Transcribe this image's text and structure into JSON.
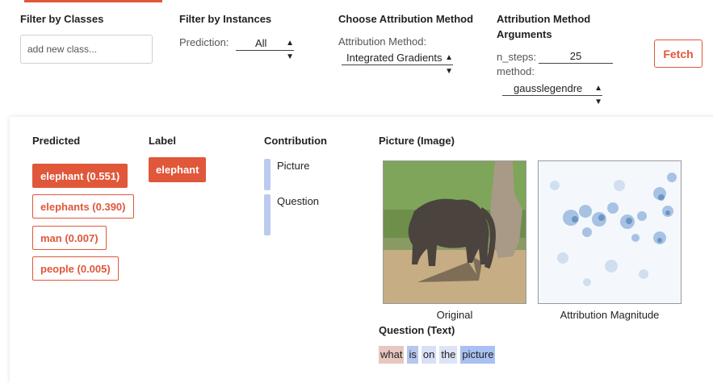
{
  "filters": {
    "classes": {
      "title": "Filter by Classes",
      "placeholder": "add new class..."
    },
    "instances": {
      "title": "Filter by Instances",
      "prediction_label": "Prediction:",
      "prediction_value": "All"
    },
    "attribution": {
      "title": "Choose Attribution Method",
      "method_label": "Attribution Method:",
      "method_value": "Integrated Gradients"
    },
    "arguments": {
      "title": "Attribution Method Arguments",
      "n_steps_label": "n_steps:",
      "n_steps_value": "25",
      "method_label": "method:",
      "method_value": "gausslegendre"
    },
    "fetch_label": "Fetch"
  },
  "results": {
    "headers": {
      "predicted": "Predicted",
      "label": "Label",
      "contribution": "Contribution",
      "picture": "Picture (Image)",
      "question": "Question (Text)"
    },
    "predictions": [
      {
        "text": "elephant (0.551)",
        "active": true
      },
      {
        "text": "elephants (0.390)",
        "active": false
      },
      {
        "text": "man (0.007)",
        "active": false
      },
      {
        "text": "people (0.005)",
        "active": false
      }
    ],
    "label": "elephant",
    "contributions": [
      {
        "name": "Picture"
      },
      {
        "name": "Question"
      }
    ],
    "image_captions": {
      "original": "Original",
      "attribution": "Attribution Magnitude"
    },
    "question_tokens": [
      {
        "text": "what",
        "color": "#e8c7c0"
      },
      {
        "text": "is",
        "color": "#b5c6ef"
      },
      {
        "text": "on",
        "color": "#d8e0f6"
      },
      {
        "text": "the",
        "color": "#dde4f6"
      },
      {
        "text": "picture",
        "color": "#a9c0f2"
      }
    ]
  },
  "colors": {
    "accent": "#e0573a",
    "contribution_bar": "#bccaf0"
  }
}
